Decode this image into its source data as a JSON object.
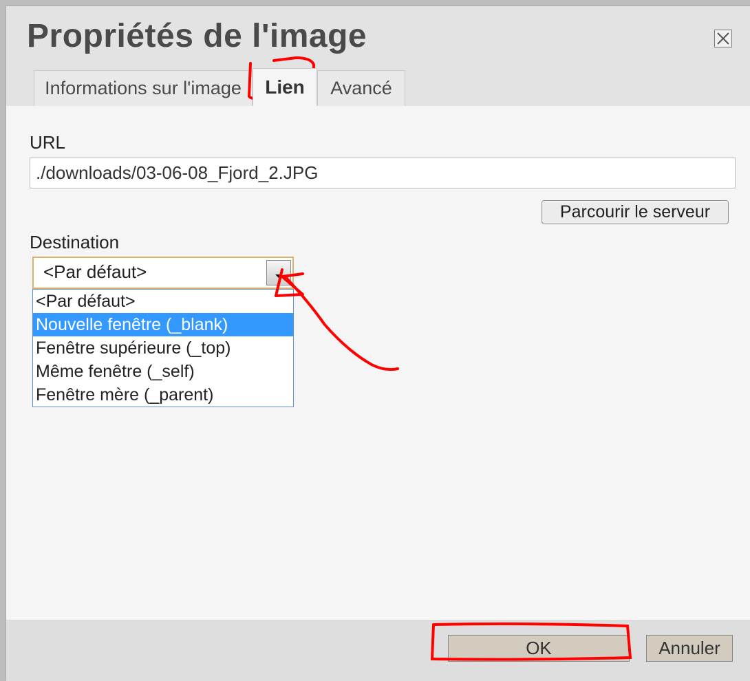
{
  "dialog": {
    "title": "Propriétés de l'image",
    "close_icon": "close-icon"
  },
  "tabs": [
    {
      "label": "Informations sur l'image"
    },
    {
      "label": "Lien"
    },
    {
      "label": "Avancé"
    }
  ],
  "link": {
    "url_label": "URL",
    "url_value": "./downloads/03-06-08_Fjord_2.JPG",
    "browse_label": "Parcourir le serveur",
    "target_label": "Destination",
    "target_value": "<Par défaut>",
    "target_options": [
      "<Par défaut>",
      "Nouvelle fenêtre (_blank)",
      "Fenêtre supérieure (_top)",
      "Même fenêtre (_self)",
      "Fenêtre mère (_parent)"
    ],
    "highlighted_option": 1
  },
  "footer": {
    "ok_label": "OK",
    "cancel_label": "Annuler"
  },
  "colors": {
    "annotation": "#ff0000",
    "highlight": "#3399ff"
  }
}
